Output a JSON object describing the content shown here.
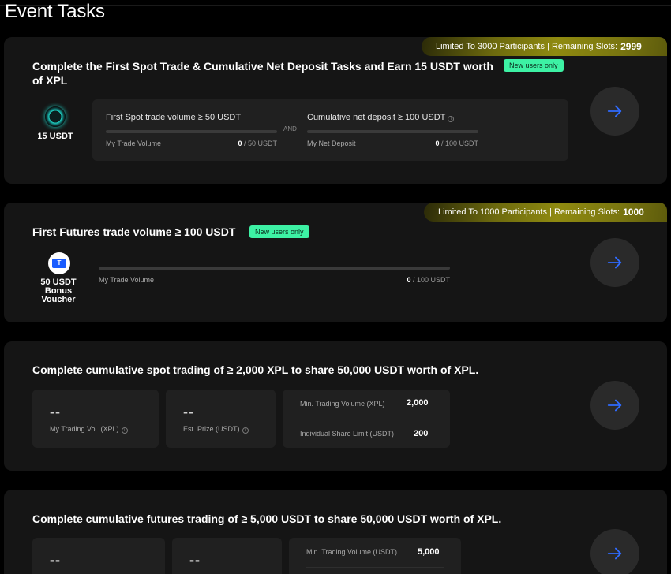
{
  "page": {
    "title": "Event Tasks"
  },
  "cards": [
    {
      "banner": {
        "text": "Limited To 3000 Participants | Remaining Slots:",
        "slots": "2999"
      },
      "title": "Complete the First Spot Trade & Cumulative Net Deposit Tasks and Earn 15 USDT worth of XPL",
      "badge": "New users only",
      "reward": "15 USDT",
      "req1": {
        "label": "First Spot trade volume ≥ 50 USDT",
        "sub": "My Trade Volume",
        "current": "0",
        "target": "/ 50 USDT"
      },
      "and": "AND",
      "req2": {
        "label": "Cumulative net deposit ≥ 100 USDT",
        "sub": "My Net Deposit",
        "current": "0",
        "target": "/ 100 USDT"
      }
    },
    {
      "banner": {
        "text": "Limited To 1000 Participants | Remaining Slots:",
        "slots": "1000"
      },
      "title": "First Futures trade volume ≥ 100 USDT",
      "badge": "New users only",
      "reward": {
        "line1": "50 USDT",
        "line2": "Bonus",
        "line3": "Voucher"
      },
      "req": {
        "sub": "My Trade Volume",
        "current": "0",
        "target": "/ 100 USDT"
      }
    },
    {
      "title": "Complete cumulative spot trading of ≥ 2,000 XPL to share 50,000 USDT worth of XPL.",
      "stat1": {
        "value": "--",
        "label": "My Trading Vol. (XPL)"
      },
      "stat2": {
        "value": "--",
        "label": "Est. Prize (USDT)"
      },
      "kv": [
        {
          "label": "Min. Trading Volume (XPL)",
          "value": "2,000"
        },
        {
          "label": "Individual Share Limit (USDT)",
          "value": "200"
        }
      ]
    },
    {
      "title": "Complete cumulative futures trading of ≥ 5,000 USDT to share 50,000 USDT worth of XPL.",
      "stat1": {
        "value": "--"
      },
      "stat2": {
        "value": "--"
      },
      "kv": [
        {
          "label": "Min. Trading Volume (USDT)",
          "value": "5,000"
        }
      ]
    }
  ],
  "colors": {
    "accent_arrow": "#2f6bff",
    "badge": "#3df1a4",
    "banner": "#8f8a10"
  },
  "icons": [
    "arrow-right-icon",
    "coin-icon",
    "voucher-icon",
    "info-icon"
  ]
}
